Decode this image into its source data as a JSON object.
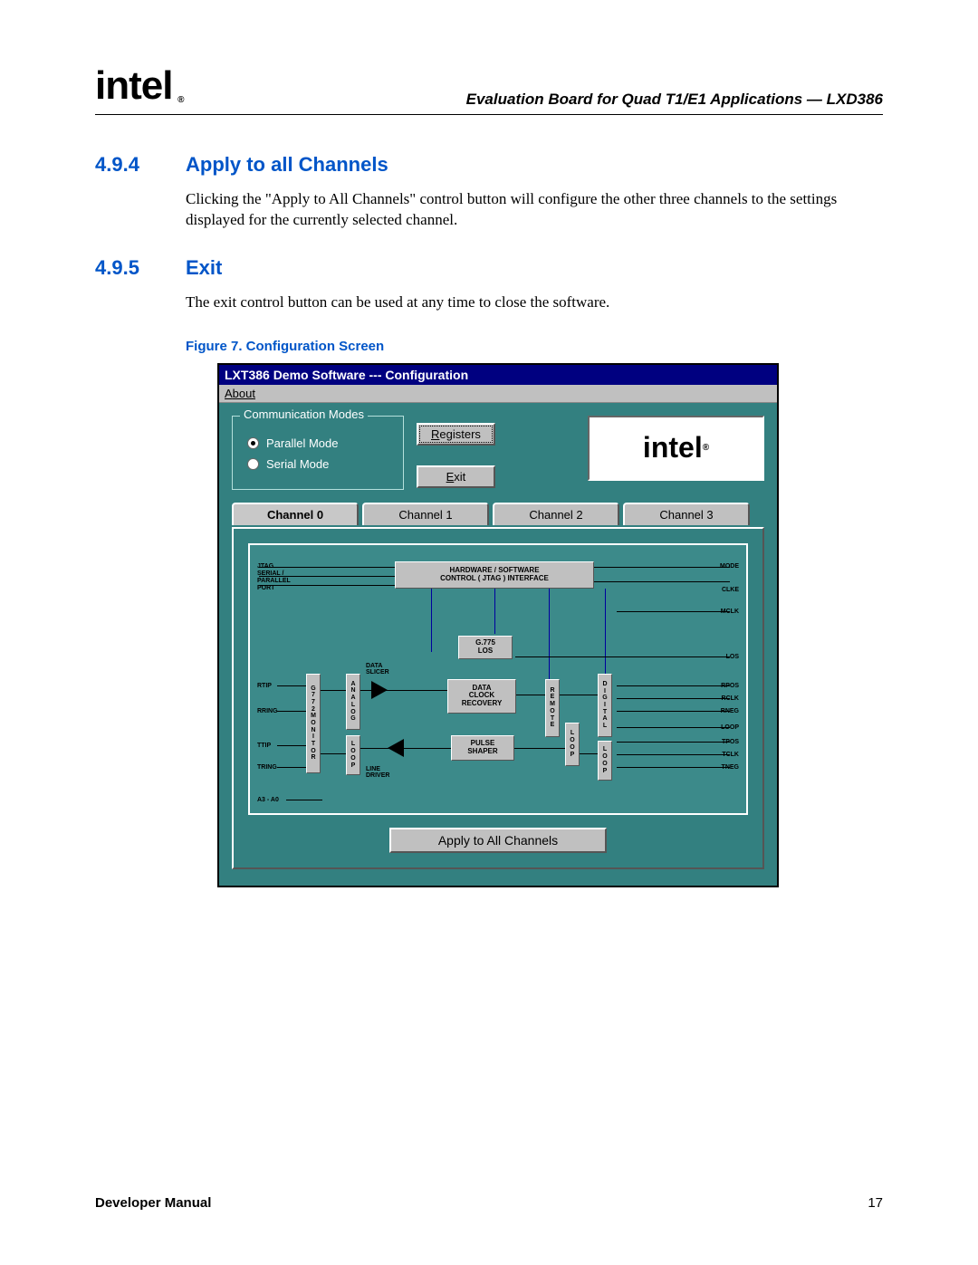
{
  "header": {
    "title": "Evaluation Board for Quad T1/E1 Applications — LXD386",
    "logo_text": "intel",
    "logo_reg": "®"
  },
  "sections": [
    {
      "num": "4.9.4",
      "title": "Apply to all Channels",
      "body": "Clicking the \"Apply to All Channels\" control button will configure the other three channels to the settings displayed for the currently selected channel."
    },
    {
      "num": "4.9.5",
      "title": "Exit",
      "body": "The exit control button can be used at any time to close the software."
    }
  ],
  "figure_caption": "Figure 7. Configuration Screen",
  "window": {
    "title": "LXT386 Demo Software --- Configuration",
    "menu_about": "About",
    "comm_modes_legend": "Communication Modes",
    "radio_parallel": "Parallel Mode",
    "radio_serial": "Serial Mode",
    "btn_registers": "Registers",
    "btn_exit": "Exit",
    "logo_text": "intel",
    "logo_reg": "®",
    "tabs": [
      "Channel 0",
      "Channel 1",
      "Channel 2",
      "Channel 3"
    ],
    "apply_btn": "Apply to All Channels",
    "diagram": {
      "left_labels": [
        "JTAG",
        "SERIAL /",
        "PARALLEL",
        "PORT",
        "RTIP",
        "RRING",
        "TTIP",
        "TRING",
        "A3 - A0"
      ],
      "right_labels": [
        "MODE",
        "CLKE",
        "MCLK",
        "LOS",
        "RPOS",
        "RCLK",
        "RNEG",
        "LOOP",
        "TPOS",
        "TCLK",
        "TNEG"
      ],
      "hw_box": "HARDWARE / SOFTWARE\nCONTROL ( JTAG ) INTERFACE",
      "g775_box": "G.775\nLOS",
      "data_box": "DATA\nCLOCK\nRECOVERY",
      "pulse_box": "PULSE\nSHAPER",
      "monitor_box": "G\n7\n7\n2\nM\nO\nN\nI\nT\nO\nR",
      "analog_box": "A\nN\nA\nL\nO\nG",
      "loop1_box": "L\nO\nO\nP",
      "remote_box": "R\nE\nM\nO\nT\nE",
      "loop2_box": "L\nO\nO\nP",
      "digital_box": "D\nI\nG\nI\nT\nA\nL",
      "loop3_box": "L\nO\nO\nP",
      "data_slicer": "DATA\nSLICER",
      "line_driver": "LINE\nDRIVER"
    }
  },
  "footer": {
    "left": "Developer Manual",
    "right": "17"
  }
}
